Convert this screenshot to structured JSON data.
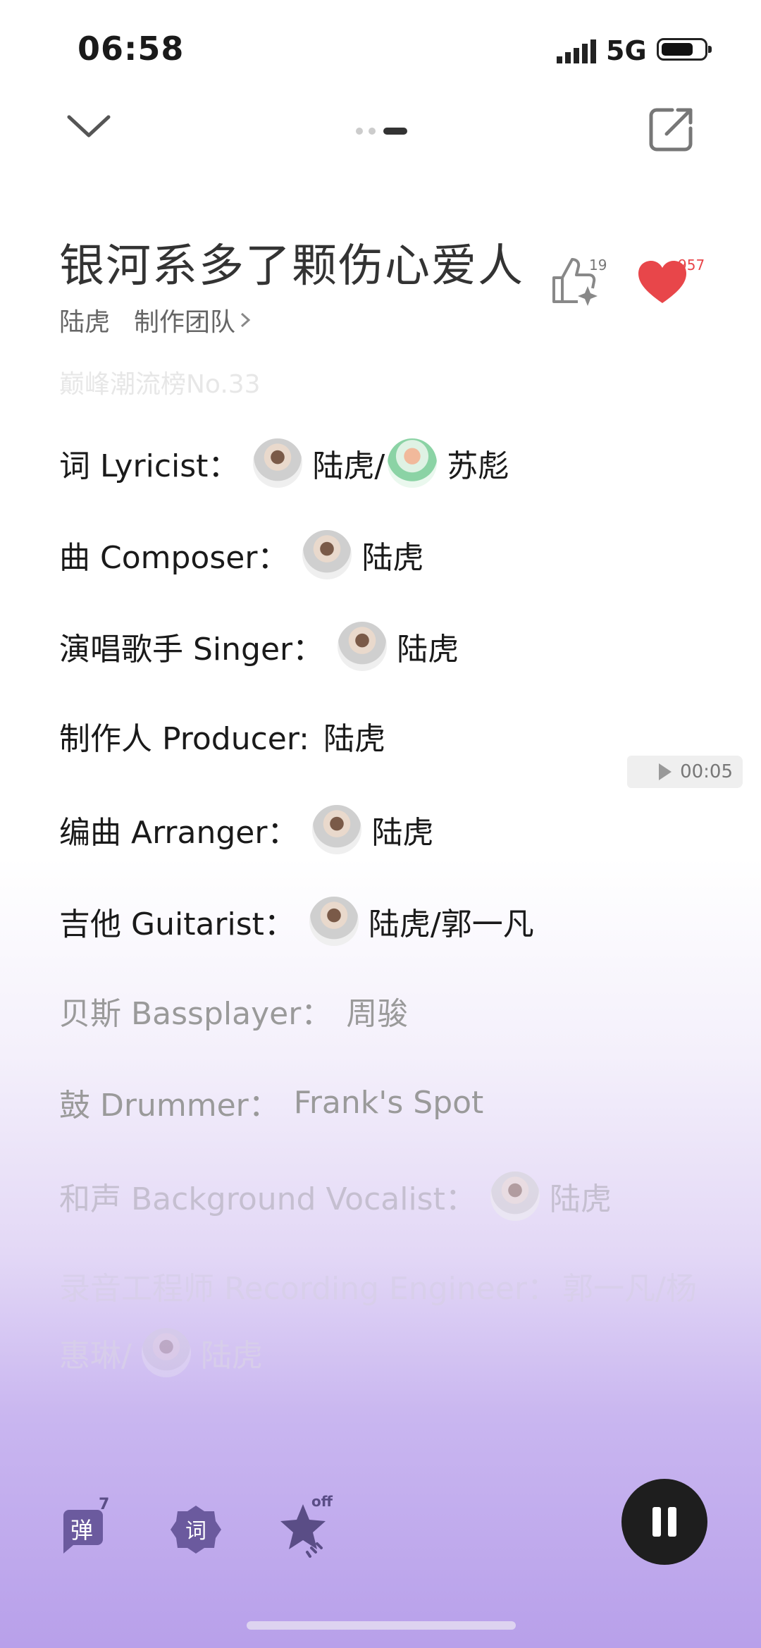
{
  "status_bar": {
    "time": "06:58",
    "network": "5G"
  },
  "header": {
    "song_title": "银河系多了颗伤心爱人",
    "artist": "陆虎",
    "team_link": "制作团队",
    "like_count": "19",
    "favorite_count": "957"
  },
  "rank_text": "巅峰潮流榜No.33",
  "credits": {
    "lyricist": {
      "label": "词 Lyricist：",
      "name1": "陆虎/",
      "name2": "苏彪"
    },
    "composer": {
      "label": "曲 Composer：",
      "name": "陆虎"
    },
    "singer": {
      "label": "演唱歌手 Singer：",
      "name": "陆虎"
    },
    "producer": {
      "label": "制作人 Producer:",
      "name": "陆虎"
    },
    "arranger": {
      "label": "编曲 Arranger：",
      "name": "陆虎"
    },
    "guitarist": {
      "label": "吉他 Guitarist：",
      "name": "陆虎/郭一凡"
    },
    "bassplayer": {
      "label": "贝斯 Bassplayer：",
      "name": "周骏"
    },
    "drummer": {
      "label": "鼓 Drummer：",
      "name": "Frank's Spot"
    },
    "background_vocalist": {
      "label": "和声 Background Vocalist：",
      "name": "陆虎"
    },
    "recording_engineer": {
      "label": "录音工程师 Recording Engineer：",
      "name": "郭一凡/杨",
      "line2_a": "惠琳/",
      "line2_b": "陆虎"
    }
  },
  "playback": {
    "timestamp": "00:05"
  },
  "controls": {
    "danmaku_icon_text": "弹",
    "danmaku_count": "7",
    "lyrics_icon_text": "词",
    "star_state": "off"
  },
  "colors": {
    "accent_red": "#e8464a",
    "bottom_purple": "#b8a0ea",
    "pause_bg": "#1e1e1e"
  }
}
